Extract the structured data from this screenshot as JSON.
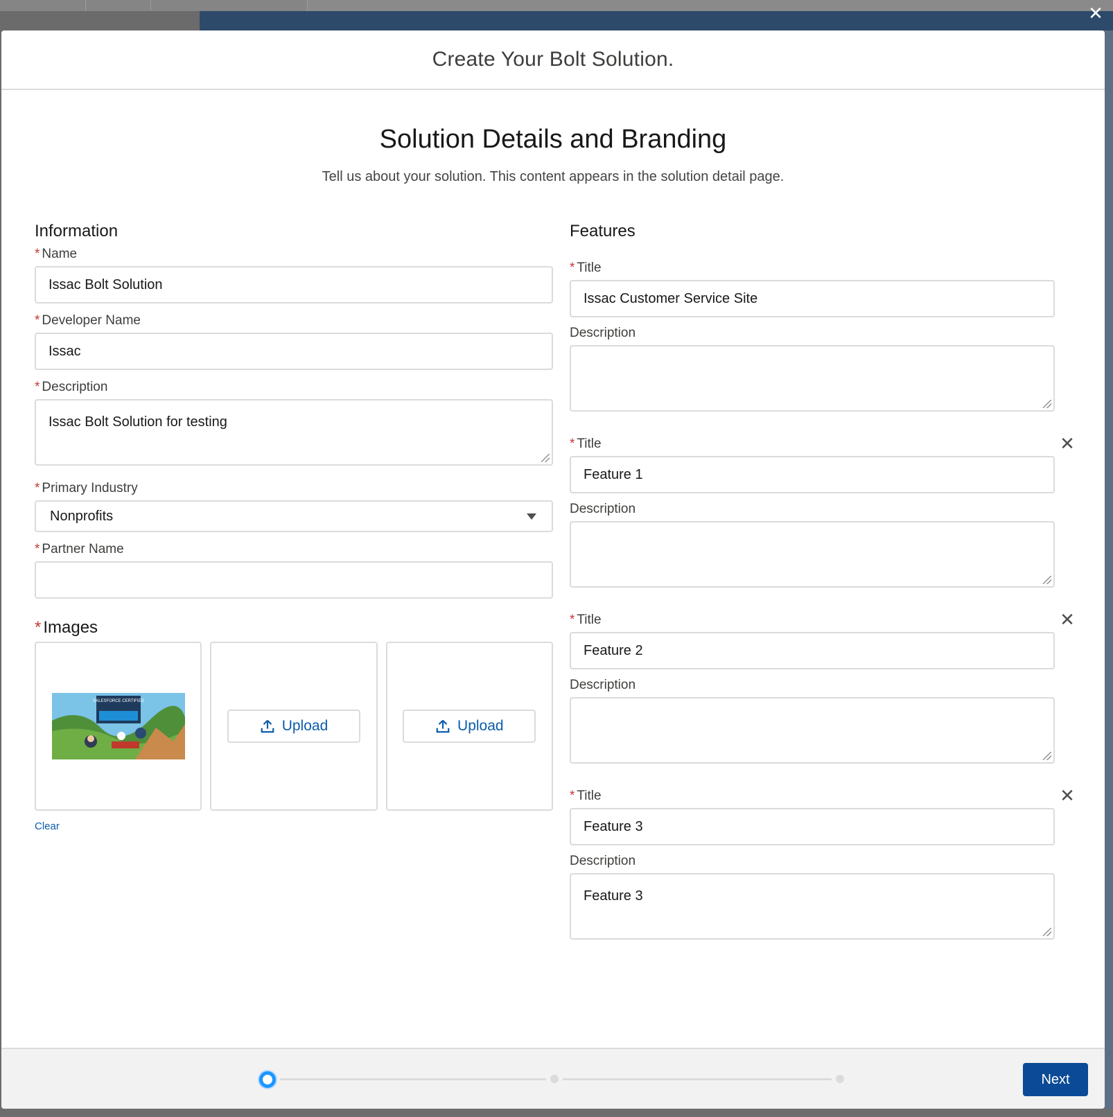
{
  "window": {
    "close_label": "✕"
  },
  "modal": {
    "title": "Create Your Bolt Solution.",
    "section_title": "Solution Details and Branding",
    "section_subtitle": "Tell us about your solution. This content appears in the solution detail page."
  },
  "information": {
    "heading": "Information",
    "name": {
      "label": "Name",
      "value": "Issac Bolt Solution"
    },
    "developer_name": {
      "label": "Developer Name",
      "value": "Issac"
    },
    "description": {
      "label": "Description",
      "value": "Issac Bolt Solution for testing"
    },
    "primary_industry": {
      "label": "Primary Industry",
      "value": "Nonprofits"
    },
    "partner_name": {
      "label": "Partner Name",
      "value": ""
    },
    "required_mark": "*"
  },
  "images": {
    "heading": "Images",
    "upload_label": "Upload",
    "clear_label": "Clear",
    "thumbnail_badge": "SALESFORCE CERTIFIED"
  },
  "features": {
    "heading": "Features",
    "title_label": "Title",
    "description_label": "Description",
    "remove_label": "✕",
    "items": [
      {
        "title": "Issac Customer Service Site",
        "description": ""
      },
      {
        "title": "Feature 1",
        "description": ""
      },
      {
        "title": "Feature 2",
        "description": ""
      },
      {
        "title": "Feature 3",
        "description": "Feature 3"
      }
    ]
  },
  "footer": {
    "next_label": "Next",
    "current_step": 1,
    "total_steps": 3
  },
  "colors": {
    "brand": "#0b4a96",
    "link": "#0b5cab",
    "required": "#c23934",
    "active_step": "#1b96ff"
  }
}
